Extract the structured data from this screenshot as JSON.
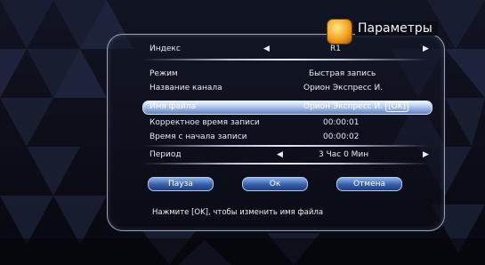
{
  "header": {
    "title": "Параметры",
    "icon": "settings-film-icon"
  },
  "rows": [
    {
      "label": "Индекс",
      "value": "R1"
    },
    {
      "label": "Режим",
      "value": "Быстрая запись"
    },
    {
      "label": "Название канала",
      "value": "Орион Экспресс И."
    },
    {
      "label": "Имя файла",
      "value": "Орион Экспресс И.",
      "badge": "[OK]"
    },
    {
      "label": "Корректное время записи",
      "value": "00:00:01"
    },
    {
      "label": "Время с начала записи",
      "value": "00:00:02"
    },
    {
      "label": "Период",
      "value": "3 Час 0 Мин"
    }
  ],
  "arrows": {
    "left": "◀",
    "right": "▶"
  },
  "buttons": {
    "pause": "Пауза",
    "ok": "Ок",
    "cancel": "Отмена"
  },
  "hint": "Нажмите [OK], чтобы изменить имя файла",
  "colors": {
    "selection": "#a7c0e9",
    "button": "#345ea9"
  }
}
